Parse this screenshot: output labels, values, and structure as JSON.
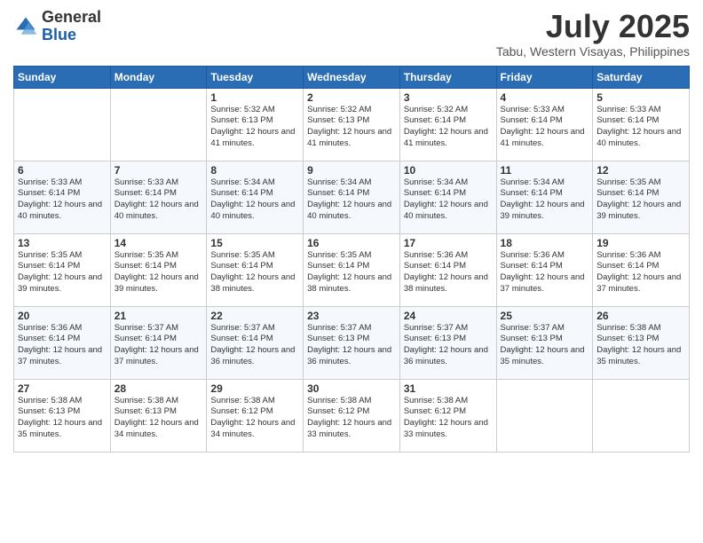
{
  "header": {
    "logo_general": "General",
    "logo_blue": "Blue",
    "month_title": "July 2025",
    "subtitle": "Tabu, Western Visayas, Philippines"
  },
  "days_of_week": [
    "Sunday",
    "Monday",
    "Tuesday",
    "Wednesday",
    "Thursday",
    "Friday",
    "Saturday"
  ],
  "weeks": [
    [
      {
        "day": "",
        "info": ""
      },
      {
        "day": "",
        "info": ""
      },
      {
        "day": "1",
        "info": "Sunrise: 5:32 AM\nSunset: 6:13 PM\nDaylight: 12 hours and 41 minutes."
      },
      {
        "day": "2",
        "info": "Sunrise: 5:32 AM\nSunset: 6:13 PM\nDaylight: 12 hours and 41 minutes."
      },
      {
        "day": "3",
        "info": "Sunrise: 5:32 AM\nSunset: 6:14 PM\nDaylight: 12 hours and 41 minutes."
      },
      {
        "day": "4",
        "info": "Sunrise: 5:33 AM\nSunset: 6:14 PM\nDaylight: 12 hours and 41 minutes."
      },
      {
        "day": "5",
        "info": "Sunrise: 5:33 AM\nSunset: 6:14 PM\nDaylight: 12 hours and 40 minutes."
      }
    ],
    [
      {
        "day": "6",
        "info": "Sunrise: 5:33 AM\nSunset: 6:14 PM\nDaylight: 12 hours and 40 minutes."
      },
      {
        "day": "7",
        "info": "Sunrise: 5:33 AM\nSunset: 6:14 PM\nDaylight: 12 hours and 40 minutes."
      },
      {
        "day": "8",
        "info": "Sunrise: 5:34 AM\nSunset: 6:14 PM\nDaylight: 12 hours and 40 minutes."
      },
      {
        "day": "9",
        "info": "Sunrise: 5:34 AM\nSunset: 6:14 PM\nDaylight: 12 hours and 40 minutes."
      },
      {
        "day": "10",
        "info": "Sunrise: 5:34 AM\nSunset: 6:14 PM\nDaylight: 12 hours and 40 minutes."
      },
      {
        "day": "11",
        "info": "Sunrise: 5:34 AM\nSunset: 6:14 PM\nDaylight: 12 hours and 39 minutes."
      },
      {
        "day": "12",
        "info": "Sunrise: 5:35 AM\nSunset: 6:14 PM\nDaylight: 12 hours and 39 minutes."
      }
    ],
    [
      {
        "day": "13",
        "info": "Sunrise: 5:35 AM\nSunset: 6:14 PM\nDaylight: 12 hours and 39 minutes."
      },
      {
        "day": "14",
        "info": "Sunrise: 5:35 AM\nSunset: 6:14 PM\nDaylight: 12 hours and 39 minutes."
      },
      {
        "day": "15",
        "info": "Sunrise: 5:35 AM\nSunset: 6:14 PM\nDaylight: 12 hours and 38 minutes."
      },
      {
        "day": "16",
        "info": "Sunrise: 5:35 AM\nSunset: 6:14 PM\nDaylight: 12 hours and 38 minutes."
      },
      {
        "day": "17",
        "info": "Sunrise: 5:36 AM\nSunset: 6:14 PM\nDaylight: 12 hours and 38 minutes."
      },
      {
        "day": "18",
        "info": "Sunrise: 5:36 AM\nSunset: 6:14 PM\nDaylight: 12 hours and 37 minutes."
      },
      {
        "day": "19",
        "info": "Sunrise: 5:36 AM\nSunset: 6:14 PM\nDaylight: 12 hours and 37 minutes."
      }
    ],
    [
      {
        "day": "20",
        "info": "Sunrise: 5:36 AM\nSunset: 6:14 PM\nDaylight: 12 hours and 37 minutes."
      },
      {
        "day": "21",
        "info": "Sunrise: 5:37 AM\nSunset: 6:14 PM\nDaylight: 12 hours and 37 minutes."
      },
      {
        "day": "22",
        "info": "Sunrise: 5:37 AM\nSunset: 6:14 PM\nDaylight: 12 hours and 36 minutes."
      },
      {
        "day": "23",
        "info": "Sunrise: 5:37 AM\nSunset: 6:13 PM\nDaylight: 12 hours and 36 minutes."
      },
      {
        "day": "24",
        "info": "Sunrise: 5:37 AM\nSunset: 6:13 PM\nDaylight: 12 hours and 36 minutes."
      },
      {
        "day": "25",
        "info": "Sunrise: 5:37 AM\nSunset: 6:13 PM\nDaylight: 12 hours and 35 minutes."
      },
      {
        "day": "26",
        "info": "Sunrise: 5:38 AM\nSunset: 6:13 PM\nDaylight: 12 hours and 35 minutes."
      }
    ],
    [
      {
        "day": "27",
        "info": "Sunrise: 5:38 AM\nSunset: 6:13 PM\nDaylight: 12 hours and 35 minutes."
      },
      {
        "day": "28",
        "info": "Sunrise: 5:38 AM\nSunset: 6:13 PM\nDaylight: 12 hours and 34 minutes."
      },
      {
        "day": "29",
        "info": "Sunrise: 5:38 AM\nSunset: 6:12 PM\nDaylight: 12 hours and 34 minutes."
      },
      {
        "day": "30",
        "info": "Sunrise: 5:38 AM\nSunset: 6:12 PM\nDaylight: 12 hours and 33 minutes."
      },
      {
        "day": "31",
        "info": "Sunrise: 5:38 AM\nSunset: 6:12 PM\nDaylight: 12 hours and 33 minutes."
      },
      {
        "day": "",
        "info": ""
      },
      {
        "day": "",
        "info": ""
      }
    ]
  ]
}
